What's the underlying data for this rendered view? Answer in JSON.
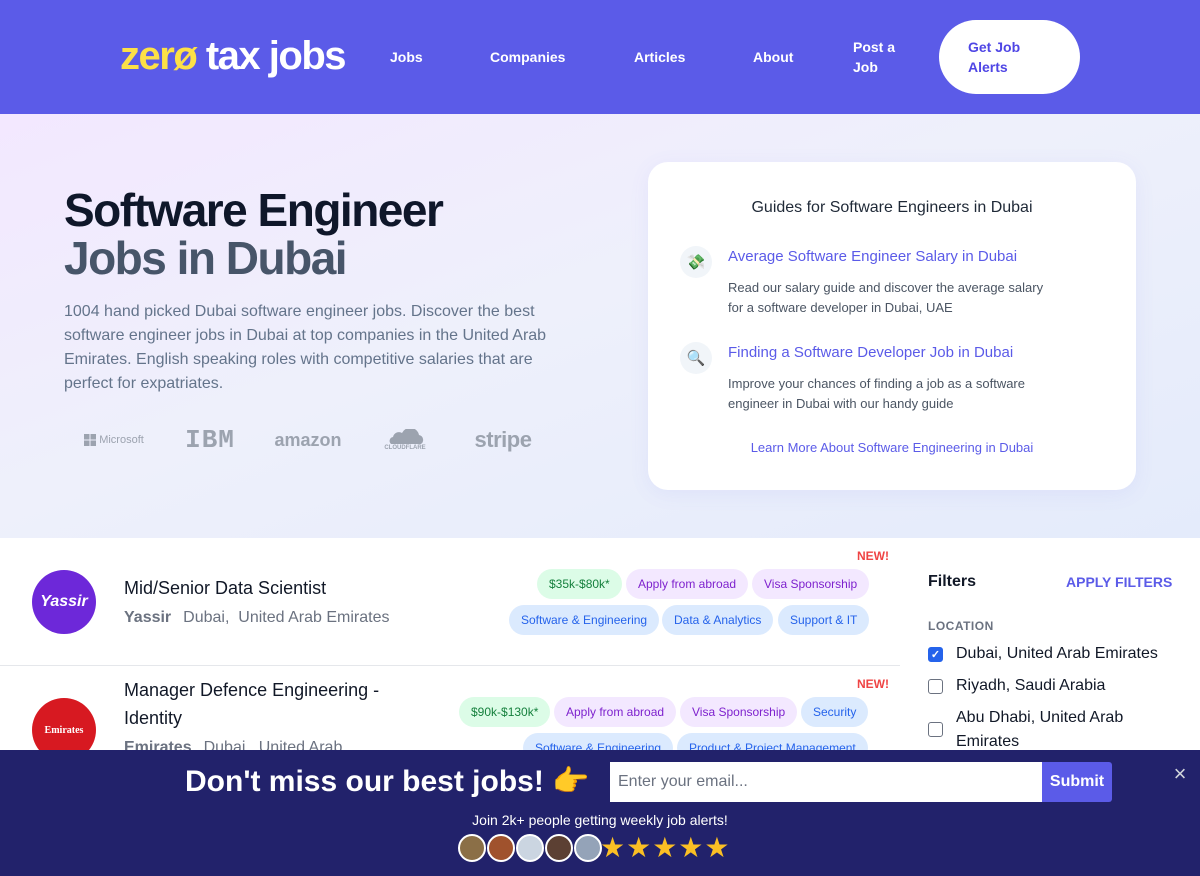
{
  "header": {
    "logo_text_a": "zerø",
    "logo_text_b": " tax jobs",
    "nav": {
      "jobs": "Jobs",
      "companies": "Companies",
      "articles": "Articles",
      "about": "About",
      "post_line1": "Post a",
      "post_line2": "Job",
      "alerts_line1": "Get Job",
      "alerts_line2": "Alerts"
    }
  },
  "hero": {
    "title_line1": "Software Engineer",
    "title_line2": "Jobs in Dubai",
    "description": "1004 hand picked Dubai software engineer jobs. Discover the best software engineer jobs in Dubai at top companies in the United Arab Emirates. English speaking roles with competitive salaries that are perfect for expatriates.",
    "brands": [
      "Microsoft",
      "IBM",
      "amazon",
      "CLOUDFLARE",
      "stripe"
    ]
  },
  "guides": {
    "title": "Guides for Software Engineers in Dubai",
    "items": [
      {
        "icon": "money-icon",
        "glyph": "💸",
        "link": "Average Software Engineer Salary in Dubai",
        "text": "Read our salary guide and discover the average salary for a software developer in Dubai, UAE"
      },
      {
        "icon": "magnifier-icon",
        "glyph": "🔍",
        "link": "Finding a Software Developer Job in Dubai",
        "text": "Improve your chances of finding a job as a software engineer in Dubai with our handy guide"
      }
    ],
    "more_link": "Learn More About Software Engineering in Dubai"
  },
  "jobs": [
    {
      "badge": "NEW!",
      "logo_text": "Yassir",
      "logo_color": "#6d28d9",
      "title": "Mid/Senior Data Scientist",
      "company": "Yassir",
      "city": "Dubai,",
      "country": "United Arab Emirates",
      "tags_row1": [
        "$35k-$80k*",
        "Apply from abroad",
        "Visa Sponsorship"
      ],
      "tags_row2": [
        "Software & Engineering",
        "Data & Analytics",
        "Support & IT"
      ]
    },
    {
      "badge": "NEW!",
      "logo_text": "Emirates",
      "logo_color": "#d71921",
      "title": "Manager Defence Engineering - Identity",
      "company": "Emirates",
      "city": "Dubai,",
      "country": "United Arab",
      "tags_row1": [
        "$90k-$130k*",
        "Apply from abroad",
        "Visa Sponsorship",
        "Security"
      ],
      "tags_row2": [
        "Software & Engineering",
        "Product & Project Management"
      ]
    }
  ],
  "filters": {
    "title": "Filters",
    "apply": "APPLY FILTERS",
    "location_label": "LOCATION",
    "options": [
      {
        "label": "Dubai, United Arab Emirates",
        "checked": true
      },
      {
        "label": "Riyadh, Saudi Arabia",
        "checked": false
      },
      {
        "label": "Abu Dhabi, United Arab Emirates",
        "checked": false
      }
    ]
  },
  "banner": {
    "headline": "Don't miss our best jobs! 👉",
    "email_placeholder": "Enter your email...",
    "submit": "Submit",
    "close": "×",
    "subtext": "Join 2k+ people getting weekly job alerts!",
    "stars": "★★★★★",
    "avatar_colors": [
      "#8b6f47",
      "#a0522d",
      "#cbd5e1",
      "#5c4033",
      "#94a3b8"
    ]
  },
  "colors": {
    "brand": "#5b5be8",
    "banner": "#22226b",
    "new": "#ef4444"
  }
}
